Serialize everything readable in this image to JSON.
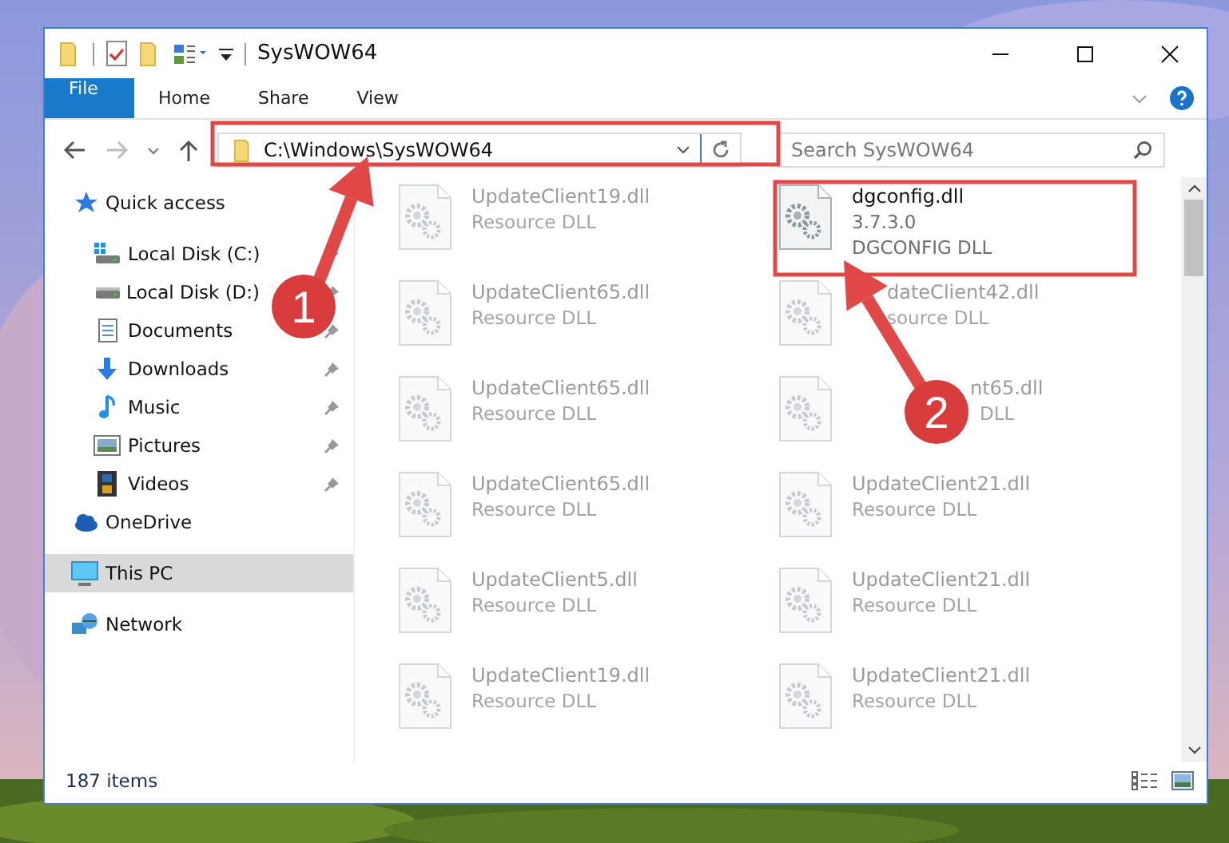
{
  "window": {
    "title": "SysWOW64"
  },
  "ribbon_tabs": [
    {
      "label": "File",
      "selected": true
    },
    {
      "label": "Home",
      "selected": false
    },
    {
      "label": "Share",
      "selected": false
    },
    {
      "label": "View",
      "selected": false
    }
  ],
  "address": {
    "path": "C:\\Windows\\SysWOW64"
  },
  "search": {
    "placeholder": "Search SysWOW64"
  },
  "nav": [
    {
      "label": "Quick access",
      "selected": false,
      "children": [
        {
          "label": "Local Disk (C:)",
          "pinned": true,
          "selected": false
        },
        {
          "label": "Local Disk (D:)",
          "pinned": true,
          "selected": false
        },
        {
          "label": "Documents",
          "pinned": true,
          "selected": false
        },
        {
          "label": "Downloads",
          "pinned": true,
          "selected": false
        },
        {
          "label": "Music",
          "pinned": true,
          "selected": false
        },
        {
          "label": "Pictures",
          "pinned": true,
          "selected": false
        },
        {
          "label": "Videos",
          "pinned": true,
          "selected": false
        }
      ]
    },
    {
      "label": "OneDrive",
      "selected": false
    },
    {
      "label": "This PC",
      "selected": true
    },
    {
      "label": "Network",
      "selected": false
    }
  ],
  "files": [
    {
      "name": "UpdateClient19.dll",
      "type": "Resource DLL",
      "faded": true
    },
    {
      "name": "dgconfig.dll",
      "version": "3.7.3.0",
      "type": "DGCONFIG DLL",
      "faded": false
    },
    {
      "name": "UpdateClient65.dll",
      "type": "Resource DLL",
      "faded": true
    },
    {
      "name": "dateClient42.dll",
      "type": "source DLL",
      "faded": true
    },
    {
      "name": "UpdateClient65.dll",
      "type": "Resource DLL",
      "faded": true
    },
    {
      "name": "nt65.dll",
      "type": "DLL",
      "faded": true
    },
    {
      "name": "UpdateClient65.dll",
      "type": "Resource DLL",
      "faded": true
    },
    {
      "name": "UpdateClient21.dll",
      "type": "Resource DLL",
      "faded": true
    },
    {
      "name": "UpdateClient5.dll",
      "type": "Resource DLL",
      "faded": true
    },
    {
      "name": "UpdateClient21.dll",
      "type": "Resource DLL",
      "faded": true
    },
    {
      "name": "UpdateClient19.dll",
      "type": "Resource DLL",
      "faded": true
    },
    {
      "name": "UpdateClient21.dll",
      "type": "Resource DLL",
      "faded": true
    }
  ],
  "status_bar": {
    "count": "187 items"
  },
  "annotations": [
    {
      "number": "1"
    },
    {
      "number": "2"
    }
  ]
}
